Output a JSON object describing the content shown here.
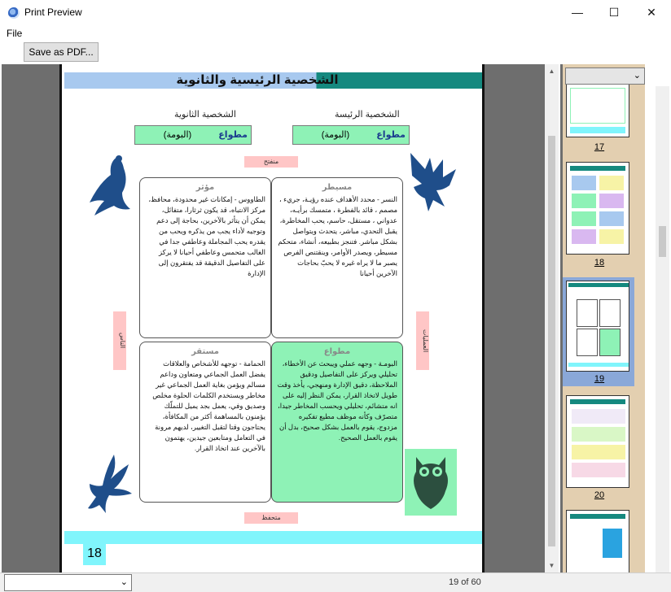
{
  "window": {
    "title": "Print Preview",
    "minimize": "—",
    "maximize": "☐",
    "close": "✕"
  },
  "menu": {
    "file": "File"
  },
  "toolbar": {
    "save_pdf": "Save as PDF..."
  },
  "page": {
    "title": "الشخصية الرئيسية والثانوية",
    "primary_heading": "الشخصية الرئيسة",
    "secondary_heading": "الشخصية الثانوية",
    "primary_type": "مطواع",
    "primary_animal": "(البومة)",
    "secondary_type": "مطواع",
    "secondary_animal": "(البومة)",
    "tag_top": "منفتح",
    "tag_bottom": "متحفظ",
    "tag_left": "الناس",
    "tag_right": "العمليات",
    "page_number": "18",
    "boxes": {
      "top_right": {
        "heading": "مسيطر",
        "text": "النسر - محدد الأهداف عنده رؤيـة، جريء ، مصمم ، قائد بالفطرة ، متمسك برأيـه، عدواني ، مستقل، حاسم، يحب المخاطرة، يقبل التحدي، مباشر، يتحدث ويتواصل بشكل مباشر. فتنجز بطبيعه، أنشاء، متحكم مسيطر، ويصدر الأوامر، وينقتنص الفرص يصبر ما لا يراه غيره لا يحبّ بحاجات الآخرين أحيانا"
      },
      "top_left": {
        "heading": "مؤثر",
        "text": "الطاووس - إمكانات غير محدودة، محافظ، مركز الانتباه، قد يكون ثرثارا، متفائل، يمكن أن يتأثر بالآخرين، بحاجة إلى دعم وتوجيه لأداء يجب من يذكره ويحب من يقدره يحب المجاملة وعاطفي جدا في الغالب متحمس وعاطفي أحيانا لا يركز على التفاصيل الدقيقة قد يفتقرون إلى الإدارة"
      },
      "bottom_right": {
        "heading": "مطواع",
        "text": "البومـة - وجهه عملي ويبحث عن الأخطاء، تحليلي ويركز على التفاصيل ودقيق الملاحظة، دقيق الإدارة ومنهجي، يأخذ وقت طويل لاتخاذ القرار، يمكن النظر إليه على انه متشائم، تحليلي ويحسب المخاطر جيدا، متصرّف وكأنه موظف مطيع تفكيره مزدوج، يقوم بالعمل بشكل صحيح، بدل أن يقوم بالعمل الصحيح."
      },
      "bottom_left": {
        "heading": "مستقر",
        "text": "الحمامة - توجهه للأشخاص والعلاقات يفضل العمل الجماعي ومتعاون وداعم مسالم ويؤمن بغاية العمل الجماعي غير مخاطر ويستخدم الكلمات الحلوة مخلص وصديق وفي، يعمل بجد يميل للتملّك يؤمنون بالمساهمة أكثر من المكافأة، يحتاجون وقتا لتقبل التغيير، لديهم مرونة في التعامل ومتابعين جيدين، يهتمون بالآخرين عند اتخاذ القرار."
      }
    }
  },
  "thumbnails": [
    {
      "label": "17"
    },
    {
      "label": "18"
    },
    {
      "label": "19"
    },
    {
      "label": "20"
    }
  ],
  "status": {
    "page_counter": "19 of 60"
  }
}
